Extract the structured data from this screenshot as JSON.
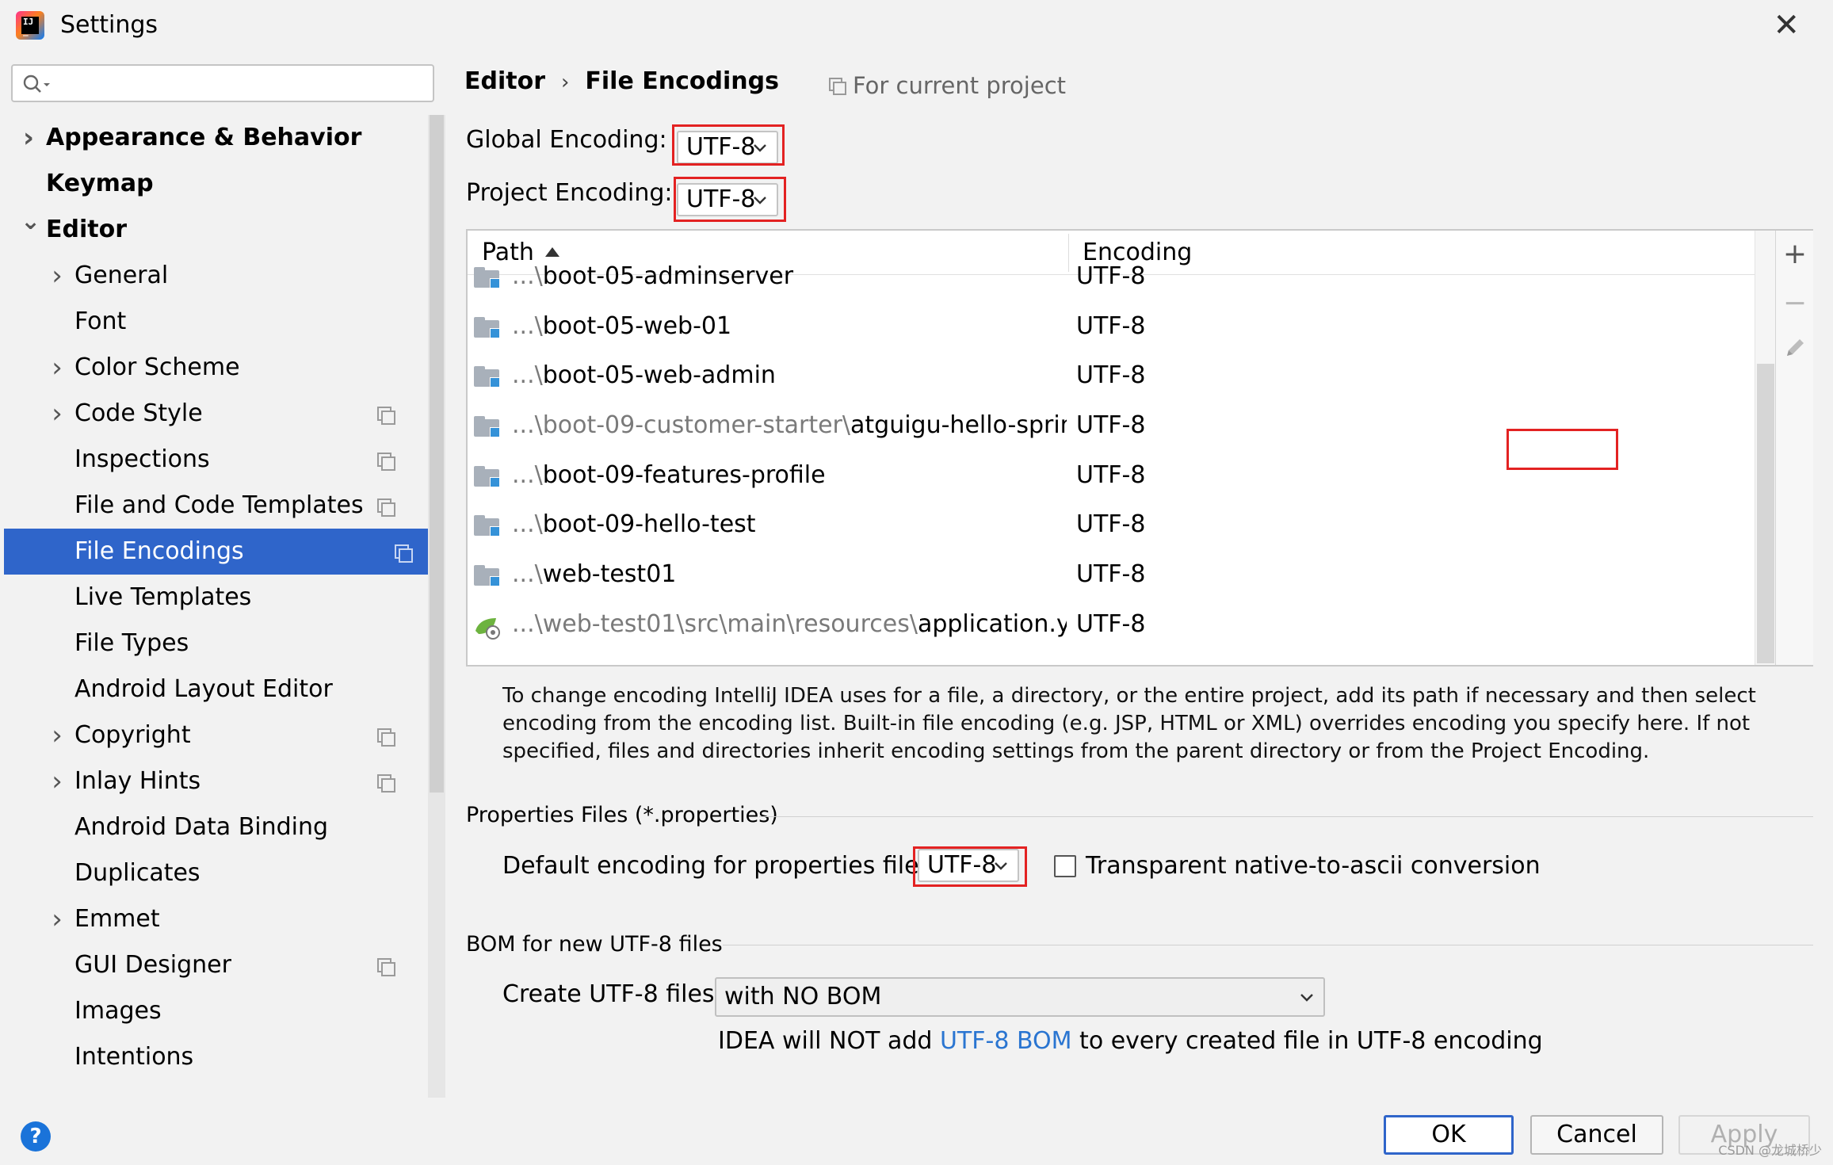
{
  "window": {
    "title": "Settings",
    "close_icon": "close-icon"
  },
  "sidebar": {
    "search_placeholder": "",
    "items": [
      {
        "label": "Appearance & Behavior",
        "level": 0,
        "expander": "collapsed",
        "bold": true,
        "project_icon": false,
        "selected": false
      },
      {
        "label": "Keymap",
        "level": 0,
        "expander": "none",
        "bold": true,
        "project_icon": false,
        "selected": false
      },
      {
        "label": "Editor",
        "level": 0,
        "expander": "expanded",
        "bold": true,
        "project_icon": false,
        "selected": false
      },
      {
        "label": "General",
        "level": 1,
        "expander": "collapsed",
        "bold": false,
        "project_icon": false,
        "selected": false
      },
      {
        "label": "Font",
        "level": 1,
        "expander": "none",
        "bold": false,
        "project_icon": false,
        "selected": false
      },
      {
        "label": "Color Scheme",
        "level": 1,
        "expander": "collapsed",
        "bold": false,
        "project_icon": false,
        "selected": false
      },
      {
        "label": "Code Style",
        "level": 1,
        "expander": "collapsed",
        "bold": false,
        "project_icon": true,
        "selected": false
      },
      {
        "label": "Inspections",
        "level": 1,
        "expander": "none",
        "bold": false,
        "project_icon": true,
        "selected": false
      },
      {
        "label": "File and Code Templates",
        "level": 1,
        "expander": "none",
        "bold": false,
        "project_icon": true,
        "selected": false
      },
      {
        "label": "File Encodings",
        "level": 1,
        "expander": "none",
        "bold": false,
        "project_icon": true,
        "selected": true
      },
      {
        "label": "Live Templates",
        "level": 1,
        "expander": "none",
        "bold": false,
        "project_icon": false,
        "selected": false
      },
      {
        "label": "File Types",
        "level": 1,
        "expander": "none",
        "bold": false,
        "project_icon": false,
        "selected": false
      },
      {
        "label": "Android Layout Editor",
        "level": 1,
        "expander": "none",
        "bold": false,
        "project_icon": false,
        "selected": false
      },
      {
        "label": "Copyright",
        "level": 1,
        "expander": "collapsed",
        "bold": false,
        "project_icon": true,
        "selected": false
      },
      {
        "label": "Inlay Hints",
        "level": 1,
        "expander": "collapsed",
        "bold": false,
        "project_icon": true,
        "selected": false
      },
      {
        "label": "Android Data Binding",
        "level": 1,
        "expander": "none",
        "bold": false,
        "project_icon": false,
        "selected": false
      },
      {
        "label": "Duplicates",
        "level": 1,
        "expander": "none",
        "bold": false,
        "project_icon": false,
        "selected": false
      },
      {
        "label": "Emmet",
        "level": 1,
        "expander": "collapsed",
        "bold": false,
        "project_icon": false,
        "selected": false
      },
      {
        "label": "GUI Designer",
        "level": 1,
        "expander": "none",
        "bold": false,
        "project_icon": true,
        "selected": false
      },
      {
        "label": "Images",
        "level": 1,
        "expander": "none",
        "bold": false,
        "project_icon": false,
        "selected": false
      },
      {
        "label": "Intentions",
        "level": 1,
        "expander": "none",
        "bold": false,
        "project_icon": false,
        "selected": false
      }
    ]
  },
  "breadcrumb": {
    "parent": "Editor",
    "current": "File Encodings",
    "scope": "For current project"
  },
  "global_encoding": {
    "label": "Global Encoding:",
    "value": "UTF-8"
  },
  "project_encoding": {
    "label": "Project Encoding:",
    "value": "UTF-8"
  },
  "table": {
    "columns": [
      "Path",
      "Encoding"
    ],
    "sort": "ascending",
    "rows": [
      {
        "icon": "module-folder-icon",
        "path_dim": "...\\",
        "path_main": "boot-05-adminserver",
        "encoding": "UTF-8"
      },
      {
        "icon": "module-folder-icon",
        "path_dim": "...\\",
        "path_main": "boot-05-web-01",
        "encoding": "UTF-8"
      },
      {
        "icon": "module-folder-icon",
        "path_dim": "...\\",
        "path_main": "boot-05-web-admin",
        "encoding": "UTF-8"
      },
      {
        "icon": "module-folder-icon",
        "path_dim": "...\\boot-09-customer-starter\\",
        "path_main": "atguigu-hello-spring-bo",
        "encoding": "UTF-8"
      },
      {
        "icon": "module-folder-icon",
        "path_dim": "...\\",
        "path_main": "boot-09-features-profile",
        "encoding": "UTF-8"
      },
      {
        "icon": "module-folder-icon",
        "path_dim": "...\\",
        "path_main": "boot-09-hello-test",
        "encoding": "UTF-8"
      },
      {
        "icon": "module-folder-icon",
        "path_dim": "...\\",
        "path_main": "web-test01",
        "encoding": "UTF-8"
      },
      {
        "icon": "spring-yaml-icon",
        "path_dim": "...\\web-test01\\src\\main\\resources\\",
        "path_main": "application.yml",
        "encoding": "UTF-8"
      }
    ],
    "tools": [
      "add-icon",
      "remove-icon",
      "edit-icon"
    ]
  },
  "help_text": "To change encoding IntelliJ IDEA uses for a file, a directory, or the entire project, add its path if necessary and then select encoding from the encoding list. Built-in file encoding (e.g. JSP, HTML or XML) overrides encoding you specify here. If not specified, files and directories inherit encoding settings from the parent directory or from the Project Encoding.",
  "properties": {
    "section_title": "Properties Files (*.properties)",
    "label": "Default encoding for properties files:",
    "value": "UTF-8",
    "checkbox_label": "Transparent native-to-ascii conversion",
    "checked": false
  },
  "bom": {
    "section_title": "BOM for new UTF-8 files",
    "label": "Create UTF-8 files:",
    "value": "with NO BOM",
    "note_prefix": "IDEA will NOT add ",
    "note_link": "UTF-8 BOM",
    "note_suffix": " to every created file in UTF-8 encoding"
  },
  "buttons": {
    "ok": "OK",
    "cancel": "Cancel",
    "apply": "Apply",
    "help": "?"
  },
  "watermark": "CSDN @龙城桥少",
  "colors": {
    "selection": "#2f65ca",
    "highlight_box": "#e32222",
    "link": "#2a75d1"
  }
}
